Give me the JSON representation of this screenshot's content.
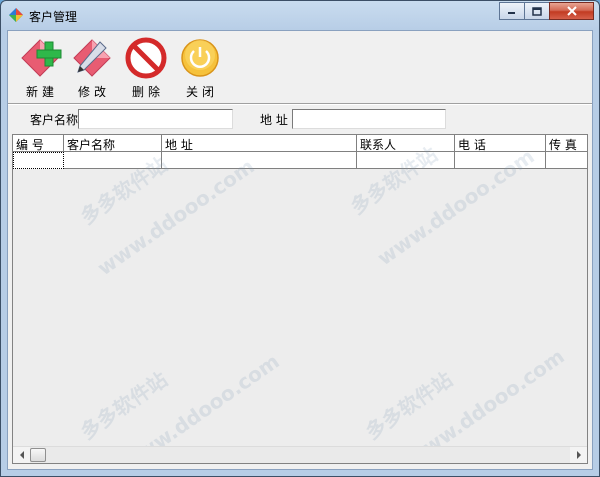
{
  "window": {
    "title": "客户管理"
  },
  "toolbar": {
    "new_label": "新建",
    "edit_label": "修改",
    "delete_label": "删除",
    "close_label": "关闭"
  },
  "search": {
    "name_label": "客户名称",
    "name_value": "",
    "address_label": "地 址",
    "address_value": ""
  },
  "grid": {
    "columns": [
      "编 号",
      "客户名称",
      "地 址",
      "联系人",
      "电 话",
      "传 真"
    ]
  },
  "watermark": {
    "cn": "多多软件站",
    "url": "www.ddooo.com"
  }
}
